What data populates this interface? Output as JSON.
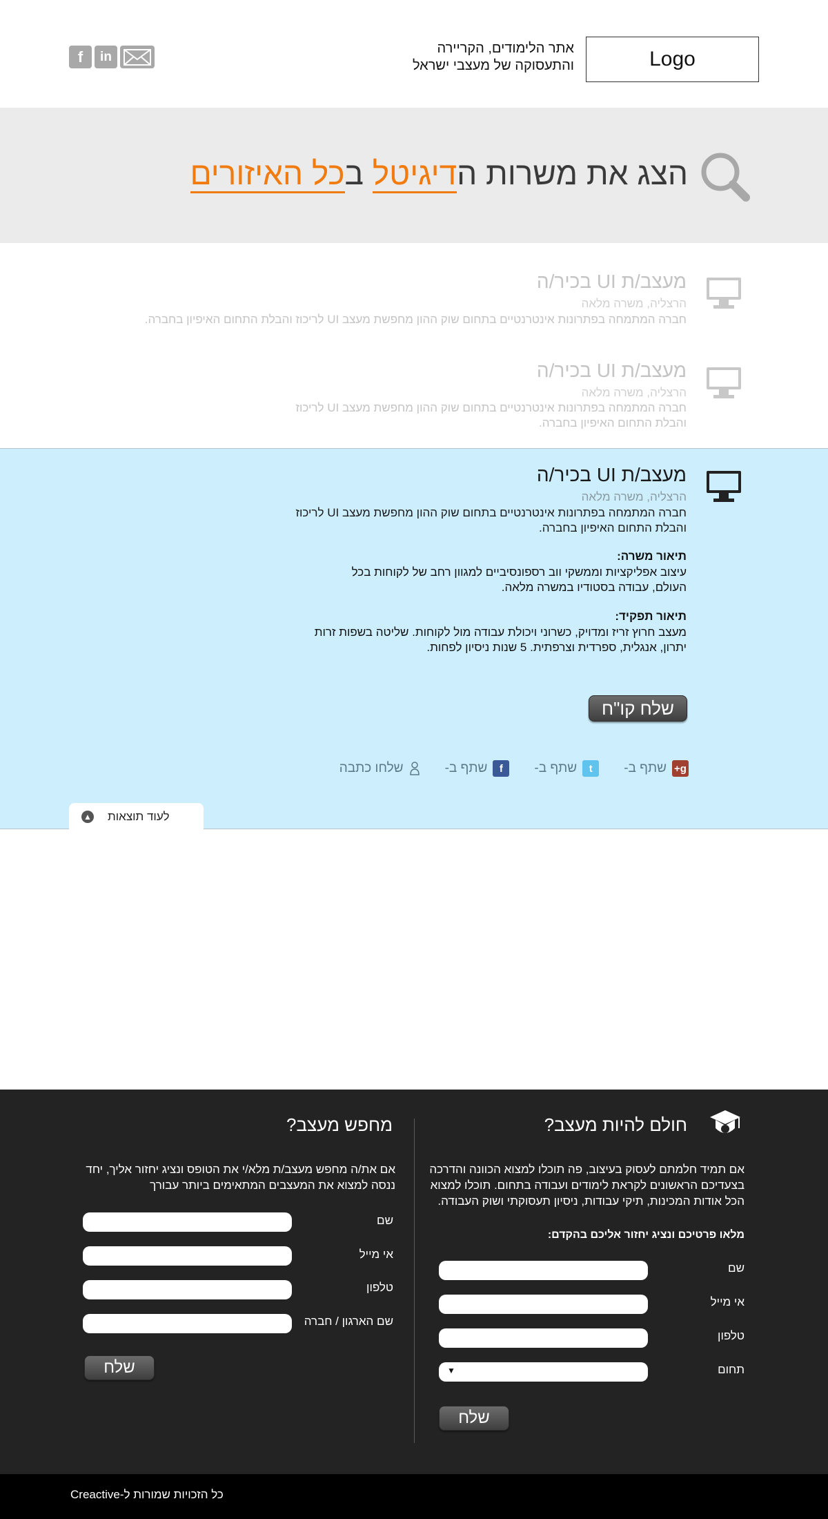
{
  "header": {
    "logo": "Logo",
    "tagline_line1": "אתר הלימודים, הקריירה",
    "tagline_line2": "והתעסוקה של מעצבי ישראל",
    "social": {
      "facebook": "f",
      "linkedin": "in"
    }
  },
  "search": {
    "part1": "הצג את משרות ה",
    "highlight1": "דיגיטל",
    "part2": " ב",
    "highlight2": "כל האיזורים"
  },
  "jobs": [
    {
      "title": "מעצב/ת UI בכיר/ה",
      "location": "הרצליה, משרה מלאה",
      "description": "חברה המתמחה בפתרונות אינטרנטיים בתחום שוק ההון מחפשת מעצב UI לריכוז והבלת התחום האיפיון בחברה."
    },
    {
      "title": "מעצב/ת UI בכיר/ה",
      "location": "הרצליה, משרה מלאה",
      "description": "חברה המתמחה בפתרונות אינטרנטיים בתחום שוק ההון מחפשת מעצב UI לריכוז והבלת התחום האיפיון בחברה."
    },
    {
      "title": "מעצב/ת UI בכיר/ה",
      "location": "הרצליה, משרה מלאה",
      "description": "חברה המתמחה בפתרונות אינטרנטיים בתחום שוק ההון מחפשת מעצב UI לריכוז והבלת התחום האיפיון בחברה.",
      "position_heading": "תיאור משרה:",
      "position_text": "עיצוב אפליקציות וממשקי ווב רספונסיביים למגוון רחב של לקוחות בכל העולם, עבודה בסטודיו במשרה מלאה.",
      "role_heading": "תיאור תפקיד:",
      "role_text": "מעצב חרוץ זריז ומדויק, כשרוני ויכולת עבודה מול לקוחות. שליטה בשפות זרות יתרון, אנגלית, ספרדית וצרפתית. 5 שנות ניסיון לפחות.",
      "cv_button": "שלח קו\"ח"
    }
  ],
  "share": {
    "email": "שלחו כתבה",
    "facebook": "שתף ב-",
    "twitter": "שתף ב-",
    "gplus": "שתף ב-"
  },
  "more_results": "לעוד תוצאות",
  "footer": {
    "dream": {
      "title": "חולם להיות מעצב?",
      "text": "אם תמיד חלמתם לעסוק בעיצוב, פה תוכלו למצוא הכוונה והדרכה בצעדיכם הראשונים לקראת לימודים ועבודה בתחום. תוכלו למצוא הכל אודות המכינות, תיקי עבודות, ניסיון תעסוקתי ושוק העבודה.",
      "prompt": "מלאו פרטיכם ונציג יחזור אליכם בהקדם:",
      "labels": [
        "שם",
        "אי מייל",
        "טלפון",
        "תחום"
      ],
      "submit": "שלח"
    },
    "seeking": {
      "title": "מחפש מעצב?",
      "text": "אם את/ה מחפש מעצב/ת מלא/י את הטופס ונציג יחזור אליך, יחד ננסה למצוא את המעצבים המתאימים ביותר עבורך",
      "labels": [
        "שם",
        "אי מייל",
        "טלפון",
        "שם הארגון / חברה"
      ],
      "submit": "שלח"
    },
    "copyright": "כל הזכויות שמורות ל-Creactive"
  },
  "colors": {
    "accent": "#f07b10",
    "active_job_bg": "#cdeefc",
    "footer_bg": "#232323"
  }
}
